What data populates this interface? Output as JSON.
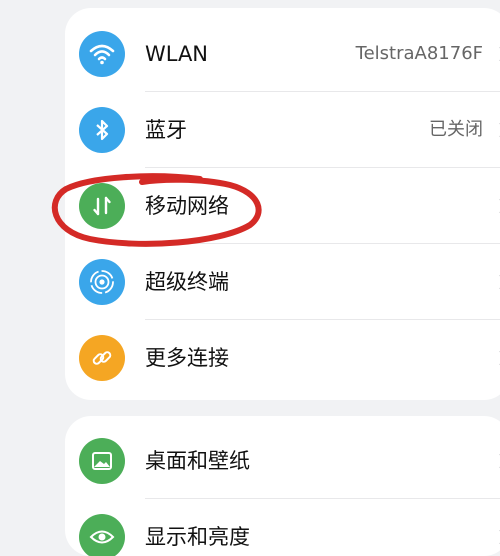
{
  "settings": {
    "group1": [
      {
        "label": "WLAN",
        "value": "TelstraA8176F",
        "icon": "wifi-icon",
        "icon_color": "#3aa6ea"
      },
      {
        "label": "蓝牙",
        "value": "已关闭",
        "icon": "bluetooth-icon",
        "icon_color": "#3aa6ea"
      },
      {
        "label": "移动网络",
        "value": "",
        "icon": "mobile-data-icon",
        "icon_color": "#4cae58"
      },
      {
        "label": "超级终端",
        "value": "",
        "icon": "super-device-icon",
        "icon_color": "#3aa6ea"
      },
      {
        "label": "更多连接",
        "value": "",
        "icon": "link-icon",
        "icon_color": "#f5a623"
      }
    ],
    "group2": [
      {
        "label": "桌面和壁纸",
        "value": "",
        "icon": "wallpaper-icon",
        "icon_color": "#4cae58"
      },
      {
        "label": "显示和亮度",
        "value": "",
        "icon": "eye-icon",
        "icon_color": "#4cae58"
      }
    ]
  },
  "annotation_color": "#d42a26"
}
